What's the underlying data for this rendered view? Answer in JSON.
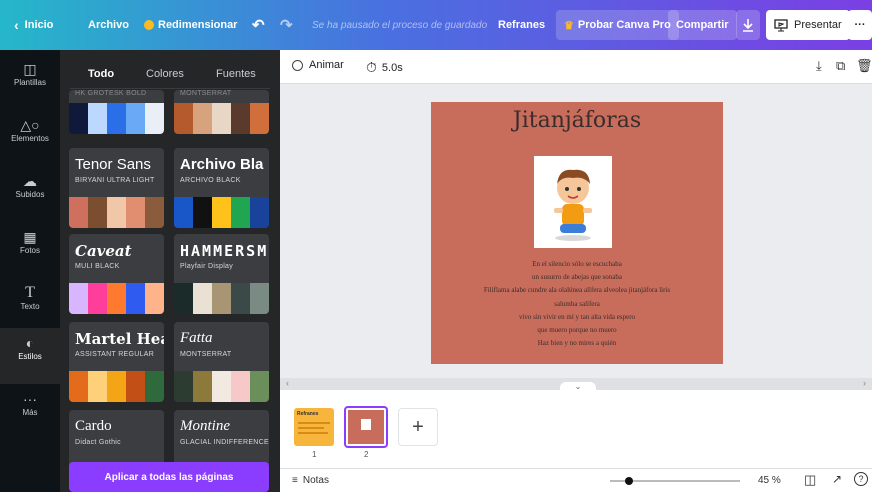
{
  "topbar": {
    "home": "Inicio",
    "file": "Archivo",
    "resize": "Redimensionar",
    "save_status": "Se ha pausado el proceso de guardado",
    "doc_title": "Refranes",
    "try_pro": "Probar Canva Pro",
    "share": "Compartir",
    "present": "Presentar",
    "more": "···"
  },
  "rail": {
    "items": [
      {
        "label": "Plantillas",
        "icon": "template-icon"
      },
      {
        "label": "Elementos",
        "icon": "elements-icon"
      },
      {
        "label": "Subidos",
        "icon": "upload-icon"
      },
      {
        "label": "Fotos",
        "icon": "photo-icon"
      },
      {
        "label": "Texto",
        "icon": "text-icon"
      },
      {
        "label": "Estilos",
        "icon": "styles-icon"
      },
      {
        "label": "Más",
        "icon": "more-icon"
      }
    ]
  },
  "panel": {
    "tabs": [
      "Todo",
      "Colores",
      "Fuentes"
    ],
    "partial_top": [
      {
        "colors": [
          "#0f1a3a",
          "#bcd8ff",
          "#2a6ee8",
          "#6aa9f5",
          "#e9eef7"
        ]
      },
      {
        "colors": [
          "#b55a2c",
          "#d7a37c",
          "#e8d7c4",
          "#5a3a2c",
          "#d06f3c"
        ]
      }
    ],
    "styles": [
      {
        "title": "Tenor Sans",
        "subtitle": "BIRYANI ULTRA LIGHT",
        "colors": [
          "#cf6f5e",
          "#7a4e2f",
          "#f0c7a8",
          "#e08e6f",
          "#8a5b3c"
        ]
      },
      {
        "title": "Archivo Bla",
        "subtitle": "ARCHIVO BLACK",
        "colors": [
          "#1956c8",
          "#111111",
          "#ffc21a",
          "#20a651",
          "#19429a"
        ]
      },
      {
        "title": "Caveat",
        "subtitle": "MULI BLACK",
        "colors": [
          "#d7b5ff",
          "#ff3d9a",
          "#ff7a2f",
          "#2f5bf0",
          "#ffb38a"
        ]
      },
      {
        "title": "HAMMERSM",
        "subtitle": "Playfair Display",
        "colors": [
          "#1b2b2a",
          "#e9e2d4",
          "#a89573",
          "#3b4a48",
          "#7a8b84"
        ]
      },
      {
        "title": "Martel Heav",
        "subtitle": "ASSISTANT REGULAR",
        "colors": [
          "#e46b1c",
          "#ffd07a",
          "#f3a516",
          "#c14f16",
          "#2f6a3d"
        ]
      },
      {
        "title": "Fatta",
        "subtitle": "MONTSERRAT",
        "colors": [
          "#2c3c30",
          "#8d7a3a",
          "#f2e9e0",
          "#f7c8c8",
          "#6a8f5a"
        ]
      },
      {
        "title": "Cardo",
        "subtitle": "Didact Gothic",
        "colors": [
          "#444",
          "#666",
          "#888",
          "#aaa",
          "#ccc"
        ]
      },
      {
        "title": "Montine",
        "subtitle": "GLACIAL INDIFFERENCE",
        "colors": [
          "#555",
          "#777",
          "#999",
          "#bbb",
          "#ddd"
        ]
      }
    ],
    "apply_label": "Aplicar a todas las páginas"
  },
  "toolbar": {
    "animate": "Animar",
    "duration": "5.0s"
  },
  "page": {
    "title": "Jitanjáforas",
    "poem": [
      "En el silencio sólo se escuchaba",
      "un susurro de abejas que sonaba",
      "Filiflama alabe cundre ala olalúnea alífera alveolea jitanjáfora liris",
      "salumba salífera",
      "vivo sin vivir en mí y tan alta vida espero",
      "que muero porque no muero",
      "Haz bien y no mires a quién"
    ]
  },
  "strip": {
    "thumb1_text": "Refranes",
    "pages": [
      "1",
      "2"
    ],
    "add": "+"
  },
  "bottom": {
    "notes": "Notas",
    "zoom": "45 %",
    "zoom_fraction": 0.45
  }
}
